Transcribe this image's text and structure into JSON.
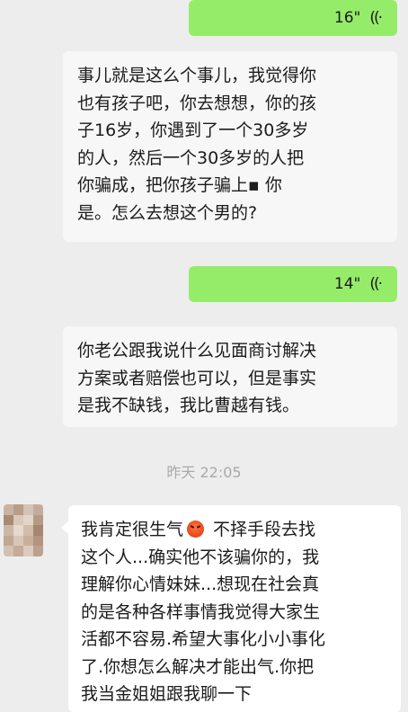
{
  "messages": {
    "voice_1": {
      "duration": "16\"",
      "icon": "voice-wave-icon"
    },
    "transcript_1": {
      "lines": [
        "事儿就是这么个事儿，我觉得你",
        "也有孩子吧，你去想想，你的孩",
        "子16岁，你遇到了一个30多岁",
        "的人，然后一个30多岁的人把",
        "你骗成，把你孩子骗上▪  你",
        "是。怎么去想这个男的?"
      ]
    },
    "voice_2": {
      "duration": "14\"",
      "icon": "voice-wave-icon"
    },
    "transcript_2": {
      "lines": [
        "你老公跟我说什么见面商讨解决",
        "方案或者赔偿也可以，但是事实",
        "是我不缺钱，我比曹越有钱。"
      ]
    },
    "timestamp": "昨天 22:05",
    "incoming_1": {
      "before_emoji": "我肯定很生气",
      "after_emoji": " 不择手段去找",
      "lines": [
        "这个人...确实他不该骗你的，我",
        "理解你心情妹妹...想现在社会真",
        "的是各种各样事情我觉得大家生",
        "活都不容易.希望大事化小小事化",
        "了.你想怎么解决才能出气.你把",
        "我当金姐姐跟我聊一下"
      ],
      "emoji": "angry-face-icon"
    }
  },
  "colors": {
    "background": "#ededed",
    "outgoing_bubble": "#95ec69",
    "transcript_bubble": "#f7f7f7",
    "incoming_bubble": "#ffffff",
    "timestamp_text": "#a9a9a9"
  }
}
